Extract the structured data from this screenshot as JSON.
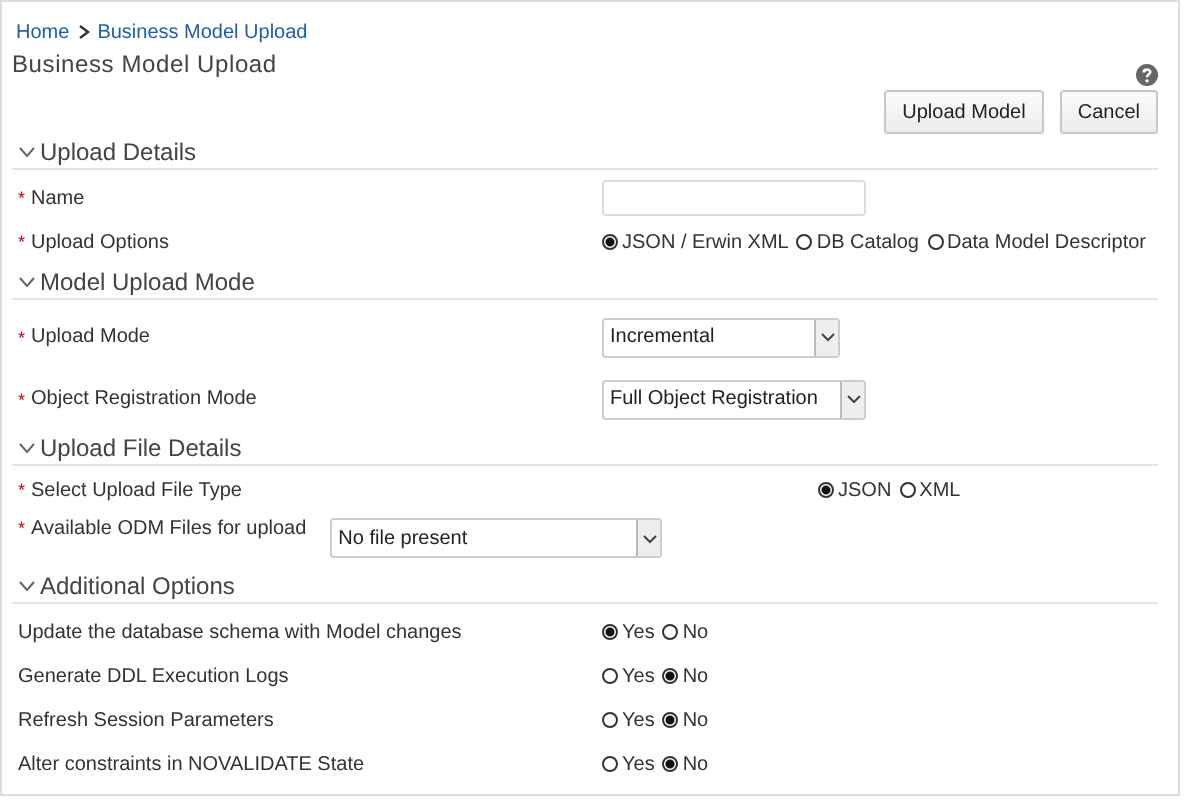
{
  "breadcrumb": [
    "Home",
    "Business Model Upload"
  ],
  "title": "Business Model Upload",
  "buttons": [
    "Upload Model",
    "Cancel"
  ],
  "sections": [
    {
      "title": "Upload Details",
      "expanded": true,
      "fields": [
        {
          "kind": "text",
          "label": "Name",
          "marker": "*"
        },
        {
          "kind": "radio",
          "label": "Upload Options",
          "marker": "*",
          "options": [
            {
              "label": "JSON / Erwin XML",
              "selected": true
            },
            {
              "label": "DB Catalog",
              "selected": false
            },
            {
              "label": "Data Model Descriptor",
              "selected": false
            }
          ]
        }
      ]
    },
    {
      "title": "Model Upload Mode",
      "expanded": true,
      "fields": [
        {
          "kind": "select",
          "label": "Upload Mode",
          "marker": "*",
          "value": "Incremental"
        },
        {
          "kind": "select_wide",
          "label": "Object Registration Mode",
          "marker": "*",
          "value": "Full Object Registration"
        }
      ]
    },
    {
      "title": "Upload File Details",
      "expanded": true,
      "fields": [
        {
          "kind": "radio_far",
          "label": "Select Upload File Type",
          "marker": "*",
          "options": [
            {
              "label": "JSON",
              "selected": true
            },
            {
              "label": "XML",
              "selected": false
            }
          ]
        },
        {
          "kind": "inline_select",
          "label": "Available ODM Files for upload",
          "marker": "*",
          "value": "No file present"
        }
      ]
    },
    {
      "title": "Additional Options",
      "expanded": true,
      "fields": [
        {
          "kind": "radio",
          "label": "Update the database schema with Model changes",
          "options": [
            {
              "label": "Yes",
              "selected": true
            },
            {
              "label": "No",
              "selected": false
            }
          ]
        },
        {
          "kind": "radio",
          "label": "Generate DDL Execution Logs",
          "options": [
            {
              "label": "Yes",
              "selected": false
            },
            {
              "label": "No",
              "selected": true
            }
          ]
        },
        {
          "kind": "radio",
          "label": "Refresh Session Parameters",
          "options": [
            {
              "label": "Yes",
              "selected": false
            },
            {
              "label": "No",
              "selected": true
            }
          ]
        },
        {
          "kind": "radio",
          "label": "Alter constraints in NOVALIDATE State",
          "options": [
            {
              "label": "Yes",
              "selected": false
            },
            {
              "label": "No",
              "selected": true
            }
          ]
        }
      ]
    }
  ]
}
